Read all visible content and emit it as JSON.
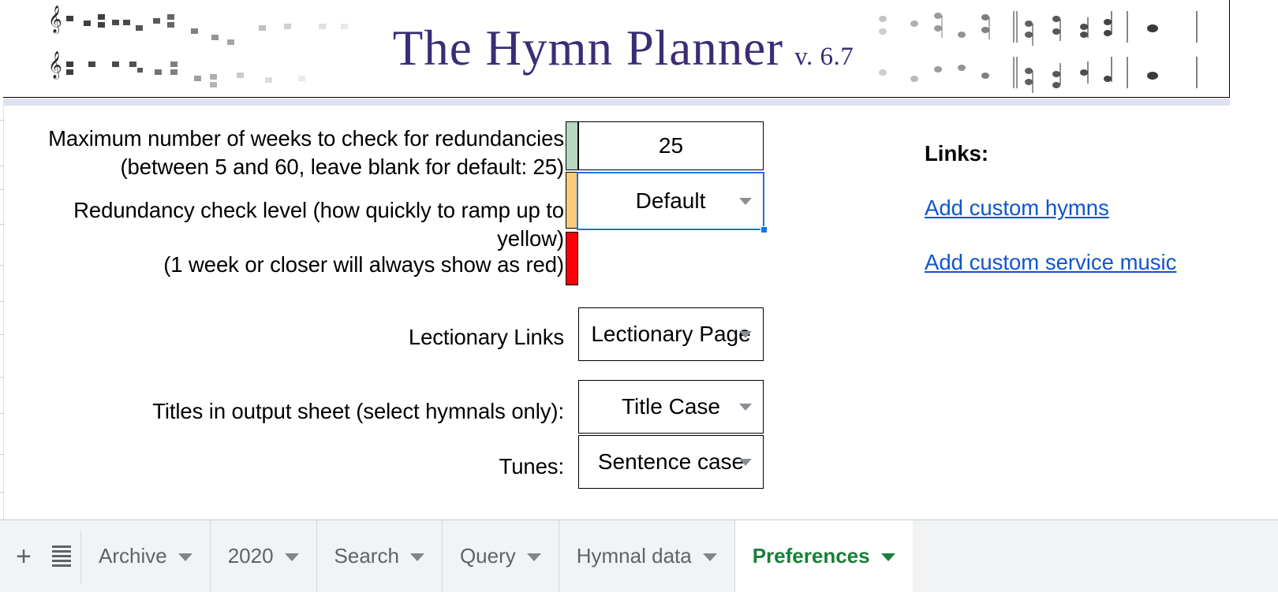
{
  "banner": {
    "title": "The Hymn Planner",
    "version": "v. 6.7",
    "left_notation_icon": "music-staff-icon",
    "right_notation_icon": "music-staff-icon"
  },
  "form": {
    "rows": [
      {
        "label": "Maximum number of weeks to check for redundancies\n(between 5 and 60, leave blank for default: 25)",
        "value": "25",
        "swatch_color": "#b6d7c2",
        "type": "text"
      },
      {
        "label": "Redundancy check level (how quickly to ramp up to yellow)",
        "value": "Default",
        "swatch_color": "#f9cb7b",
        "type": "dropdown",
        "selected": true
      },
      {
        "label": "(1 week or closer will always show as red)",
        "value": "",
        "swatch_color": "#fb0007",
        "type": "blank"
      },
      {
        "label": "Lectionary Links",
        "value": "Lectionary Page",
        "type": "dropdown"
      },
      {
        "label": "Titles in output sheet (select hymnals only):",
        "value": "Title Case",
        "type": "dropdown"
      },
      {
        "label": "Tunes:",
        "value": "Sentence case",
        "type": "dropdown"
      }
    ]
  },
  "links_panel": {
    "heading": "Links:",
    "items": [
      {
        "label": "Add custom hymns"
      },
      {
        "label": "Add custom service music"
      }
    ]
  },
  "tabbar": {
    "add_sheet_label": "+",
    "all_sheets_icon": "hamburger-icon",
    "tabs": [
      {
        "label": "Archive",
        "active": false
      },
      {
        "label": "2020",
        "active": false
      },
      {
        "label": "Search",
        "active": false
      },
      {
        "label": "Query",
        "active": false
      },
      {
        "label": "Hymnal data",
        "active": false
      },
      {
        "label": "Preferences",
        "active": true
      }
    ]
  },
  "colors": {
    "title_purple": "#3c2c76",
    "link_blue": "#1155cc",
    "selection_blue": "#1a73e8",
    "active_tab_green": "#188038"
  }
}
